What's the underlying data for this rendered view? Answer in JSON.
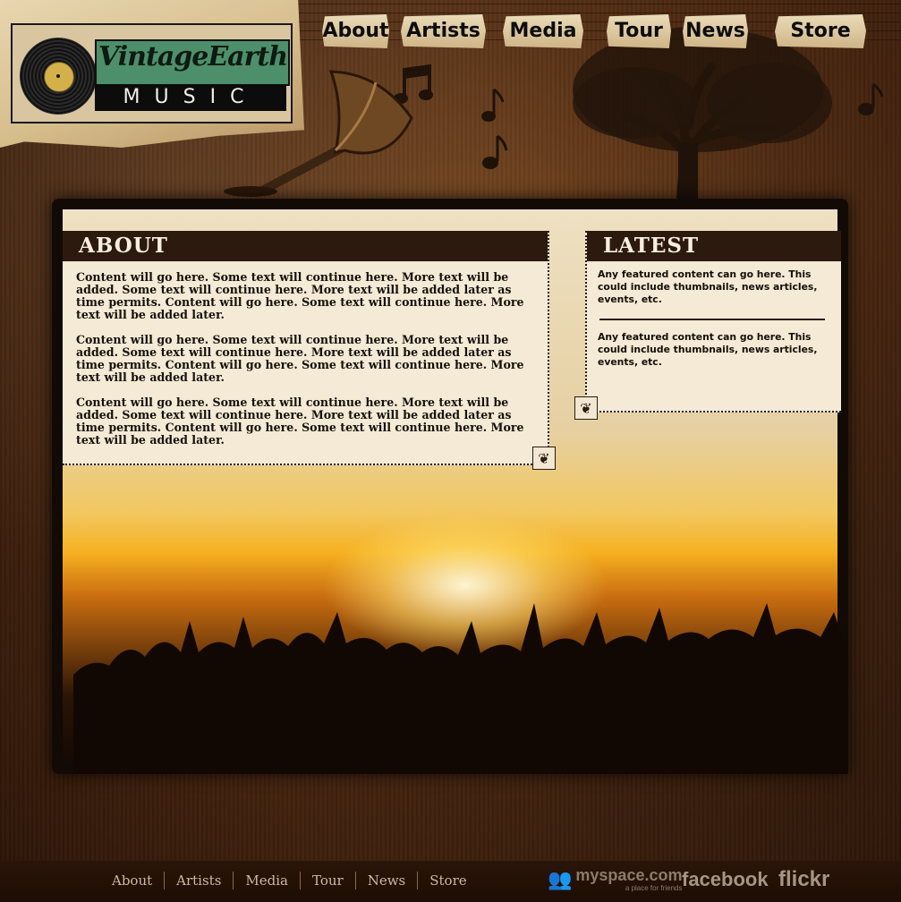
{
  "brand": {
    "title": "VintageEarth",
    "subtitle": "MUSIC"
  },
  "topnav": {
    "items": [
      "About",
      "Artists",
      "Media",
      "Tour",
      "News",
      "Store"
    ]
  },
  "about": {
    "heading": "ABOUT",
    "paragraphs": [
      "Content will go here. Some text will continue here. More text will be added.  Some text will continue here. More text will be added later as time permits. Content will go here. Some text will continue here. More text will be added later.",
      "Content will go here. Some text will continue here. More text will be added.  Some text will continue here. More text will be added later as time permits. Content will go here. Some text will continue here. More text will be added later.",
      "Content will go here. Some text will continue here. More text will be added.  Some text will continue here. More text will be added later as time permits. Content will go here. Some text will continue here. More text will be added later."
    ]
  },
  "latest": {
    "heading": "LATEST",
    "items": [
      "Any featured content can go here. This could include thumbnails, news articles, events, etc.",
      "Any featured content can go here. This could include thumbnails, news articles, events, etc."
    ]
  },
  "footer": {
    "nav": [
      "About",
      "Artists",
      "Media",
      "Tour",
      "News",
      "Store"
    ],
    "myspace": "myspace.com",
    "myspace_tagline": "a place for friends",
    "facebook": "facebook",
    "flickr": "flickr"
  },
  "icons": {
    "logo_record": "vinyl-record-icon",
    "gramophone": "gramophone-icon",
    "tree": "tree-icon",
    "music_notes": "music-note-icon",
    "corner": "ornament-icon"
  },
  "colors": {
    "panel_head": "#2d1a0f",
    "panel_bg": "#f4ead6",
    "logo_green": "#4d8f6a",
    "footer_link": "#cdb99a"
  }
}
